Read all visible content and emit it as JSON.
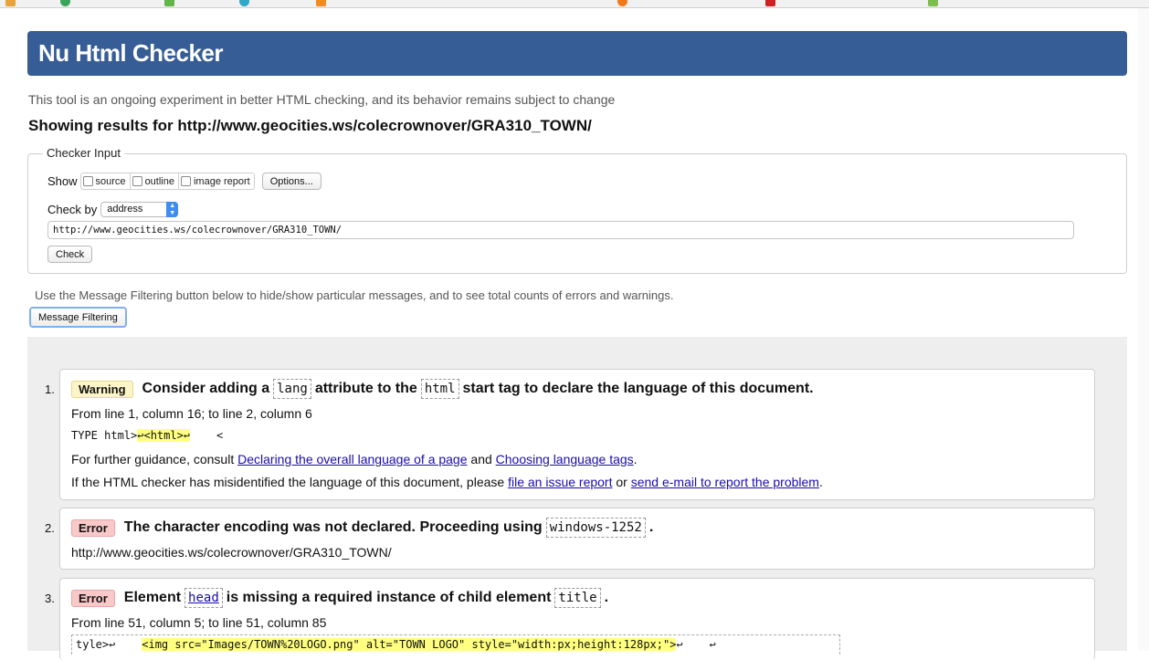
{
  "header": {
    "title": "Nu Html Checker",
    "subtitle": "This tool is an ongoing experiment in better HTML checking, and its behavior remains subject to change",
    "showing_results": "Showing results for http://www.geocities.ws/colecrownover/GRA310_TOWN/"
  },
  "checker_input": {
    "legend": "Checker Input",
    "show_label": "Show",
    "options": [
      {
        "label": "source",
        "checked": false
      },
      {
        "label": "outline",
        "checked": false
      },
      {
        "label": "image report",
        "checked": false
      }
    ],
    "options_button": "Options...",
    "check_by_label": "Check by",
    "check_by_value": "address",
    "url_value": "http://www.geocities.ws/colecrownover/GRA310_TOWN/",
    "check_button": "Check"
  },
  "filter": {
    "note": "Use the Message Filtering button below to hide/show particular messages, and to see total counts of errors and warnings.",
    "button": "Message Filtering"
  },
  "messages": [
    {
      "num": "1.",
      "type": "Warning",
      "t1": "Consider adding a",
      "c1": "lang",
      "t2": "attribute to the",
      "c2": "html",
      "t3": "start tag to declare the language of this document.",
      "location": "From line 1, column 16; to line 2, column 6",
      "extract_pre": "TYPE html>",
      "extract_hl": "↩<html>↩",
      "extract_post": "    <",
      "guidance_pre": "For further guidance, consult",
      "link1": "Declaring the overall language of a page",
      "guidance_and": "and",
      "link2": "Choosing language tags",
      "guidance_end": ".",
      "report_pre": "If the HTML checker has misidentified the language of this document, please",
      "link3": "file an issue report",
      "report_or": "or",
      "link4": "send e-mail to report the problem",
      "report_end": "."
    },
    {
      "num": "2.",
      "type": "Error",
      "t1": "The character encoding was not declared. Proceeding using",
      "c1": "windows-1252",
      "t2": ".",
      "url": "http://www.geocities.ws/colecrownover/GRA310_TOWN/"
    },
    {
      "num": "3.",
      "type": "Error",
      "t1": "Element",
      "c1": "head",
      "t2": "is missing a required instance of child element",
      "c2": "title",
      "t3": ".",
      "location": "From line 51, column 5; to line 51, column 85",
      "extract_pre": "tyle>↩    ",
      "extract_hl": "<img src=\"Images/TOWN%20LOGO.png\" alt=\"TOWN LOGO\" style=\"width:px;height:128px;\">",
      "extract_post": "↩    ↩"
    }
  ]
}
